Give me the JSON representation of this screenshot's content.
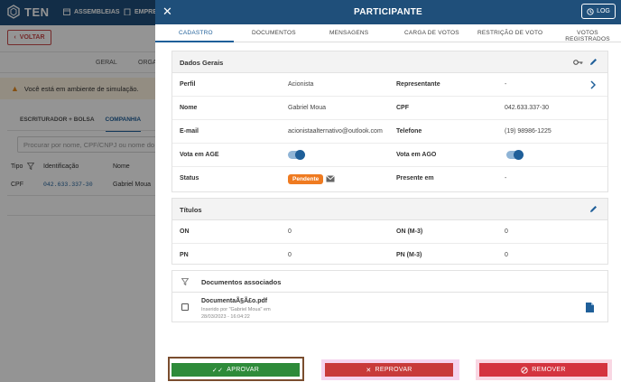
{
  "app": {
    "logo_text": "TEN",
    "nav": [
      "ASSEMBLEIAS",
      "EMPRE"
    ],
    "back_label": "VOLTAR",
    "tabs": [
      "GERAL",
      "ORGA"
    ],
    "alert": "Você está em ambiente de simulação.",
    "subtabs": [
      "ESCRITURADOR + BOLSA",
      "COMPANHIA"
    ],
    "search_placeholder": "Procurar por nome, CPF/CNPJ ou nome do",
    "grid": {
      "headers": [
        "Tipo",
        "Identificação",
        "Nome"
      ],
      "row": [
        "CPF",
        "042.633.337-30",
        "Gabriel Moua"
      ]
    }
  },
  "modal": {
    "title": "PARTICIPANTE",
    "log_label": "LOG",
    "tabs": [
      "CADASTRO",
      "DOCUMENTOS",
      "MENSAGENS",
      "CARGA DE VOTOS",
      "RESTRIÇÃO DE VOTO",
      "VOTOS REGISTRADOS"
    ],
    "active_tab": "CADASTRO",
    "dados_gerais": {
      "title": "Dados Gerais",
      "perfil_label": "Perfil",
      "perfil": "Acionista",
      "representante_label": "Representante",
      "representante": "-",
      "nome_label": "Nome",
      "nome": "Gabriel Moua",
      "cpf_label": "CPF",
      "cpf": "042.633.337-30",
      "email_label": "E-mail",
      "email": "acionistaalternativo@outlook.com",
      "telefone_label": "Telefone",
      "telefone": "(19) 98986-1225",
      "vota_age_label": "Vota em AGE",
      "vota_age": true,
      "vota_ago_label": "Vota em AGO",
      "vota_ago": true,
      "status_label": "Status",
      "status": "Pendente",
      "presente_label": "Presente em",
      "presente": "-"
    },
    "titulos": {
      "title": "Títulos",
      "on_label": "ON",
      "on": "0",
      "on_m3_label": "ON (M-3)",
      "on_m3": "0",
      "pn_label": "PN",
      "pn": "0",
      "pn_m3_label": "PN (M-3)",
      "pn_m3": "0"
    },
    "documentos": {
      "title": "Documentos associados",
      "file_name": "DocumentaÃ§Ã£o.pdf",
      "meta_line1": "Inserido por \"Gabriel Moua\" em",
      "meta_line2": "28/03/2023 - 16:04:22"
    },
    "buttons": {
      "aprovar": "APROVAR",
      "reprovar": "REPROVAR",
      "remover": "REMOVER"
    }
  },
  "colors": {
    "header": "#1f4f7a",
    "accent": "#1f5f99",
    "approve": "#2e8b3a",
    "reject": "#c83a3a",
    "remove": "#d4333f",
    "pending": "#ef7b21"
  }
}
